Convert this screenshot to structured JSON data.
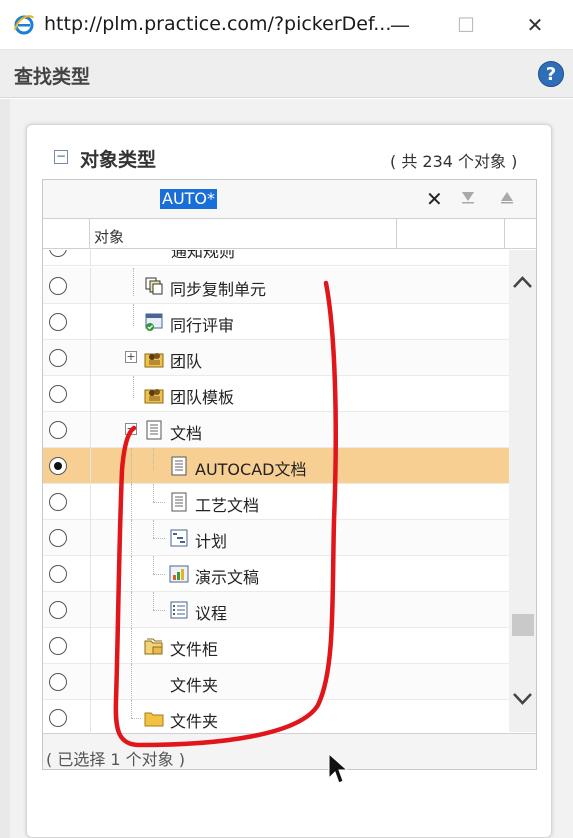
{
  "window": {
    "url": "http://plm.practice.com/?pickerDef...",
    "minimize_glyph": "—",
    "maximize_glyph": "☐",
    "close_glyph": "✕"
  },
  "header": {
    "title": "查找类型",
    "help_glyph": "?"
  },
  "panel": {
    "collapse_glyph": "−",
    "title": "对象类型",
    "count_text": "( 共 234 个对象 )"
  },
  "search": {
    "value": "AUTO*",
    "clear_glyph": "✕"
  },
  "table": {
    "column_header": "对象",
    "rows": [
      {
        "label": "通知规则",
        "selected": false
      },
      {
        "label": "同步复制单元",
        "selected": false,
        "icon": "replication-unit-icon"
      },
      {
        "label": "同行评审",
        "selected": false,
        "icon": "peer-review-icon"
      },
      {
        "label": "团队",
        "selected": false,
        "icon": "team-icon",
        "expander": "+"
      },
      {
        "label": "团队模板",
        "selected": false,
        "icon": "team-template-icon"
      },
      {
        "label": "文档",
        "selected": false,
        "icon": "document-icon",
        "expander": "−"
      },
      {
        "label": "AUTOCAD文档",
        "selected": true,
        "icon": "document-icon"
      },
      {
        "label": "工艺文档",
        "selected": false,
        "icon": "document-icon"
      },
      {
        "label": "计划",
        "selected": false,
        "icon": "plan-icon"
      },
      {
        "label": "演示文稿",
        "selected": false,
        "icon": "presentation-icon"
      },
      {
        "label": "议程",
        "selected": false,
        "icon": "agenda-icon"
      },
      {
        "label": "文件柜",
        "selected": false,
        "icon": "cabinet-icon"
      },
      {
        "label": "文件夹",
        "selected": false
      },
      {
        "label": "文件夹",
        "selected": false,
        "icon": "folder-icon"
      }
    ]
  },
  "footer": {
    "status_text": "( 已选择 1 个对象 )"
  },
  "colors": {
    "selected_row": "#f8cf92",
    "annotation": "#e0161b",
    "help": "#2f6fb7"
  }
}
